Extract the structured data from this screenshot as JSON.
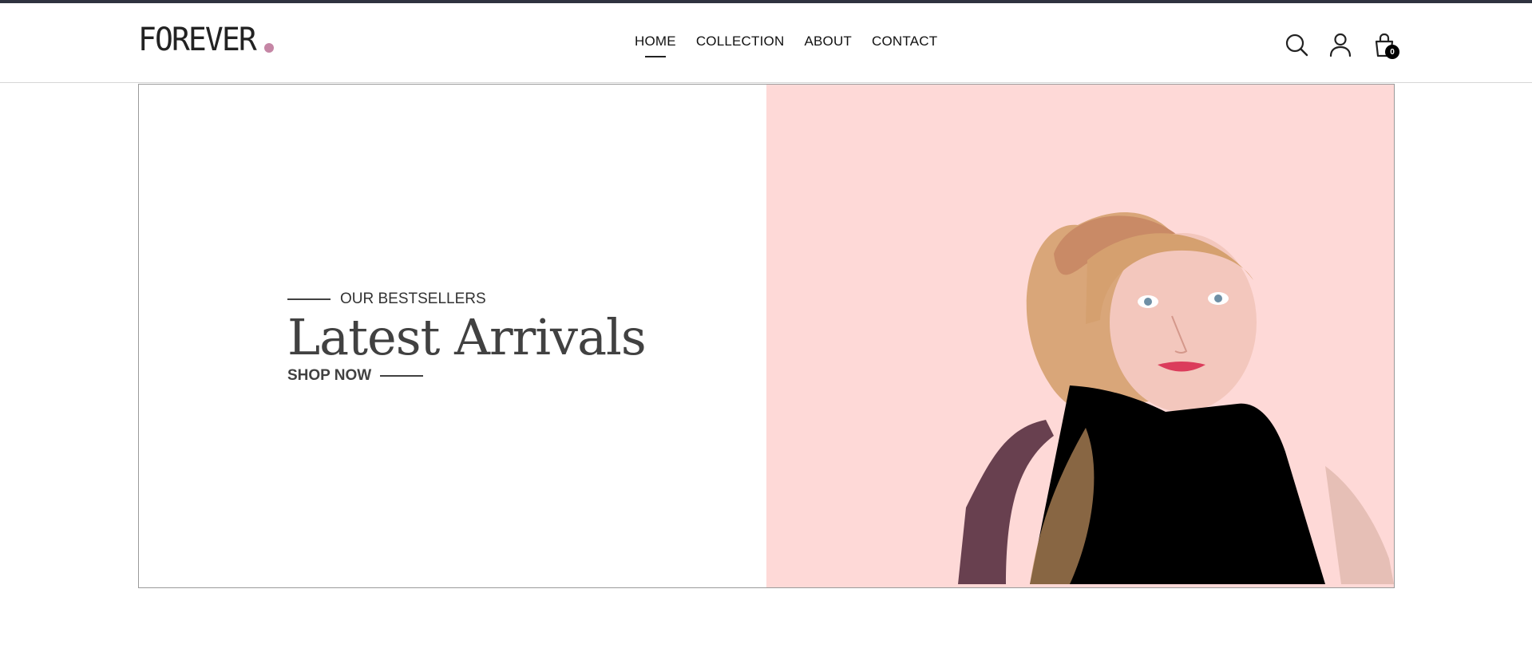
{
  "header": {
    "logo_text": "FOREVER",
    "logo_dot_color": "#c586a5",
    "nav": [
      {
        "label": "HOME",
        "active": true
      },
      {
        "label": "COLLECTION",
        "active": false
      },
      {
        "label": "ABOUT",
        "active": false
      },
      {
        "label": "CONTACT",
        "active": false
      }
    ],
    "icons": [
      "search-icon",
      "profile-icon",
      "cart-icon"
    ],
    "cart_count": "0"
  },
  "hero": {
    "eyebrow": "OUR BESTSELLERS",
    "headline": "Latest Arrivals",
    "cta": "SHOP NOW",
    "image_background": "#fed9d7",
    "image_subject": "fashion-model-photo"
  }
}
